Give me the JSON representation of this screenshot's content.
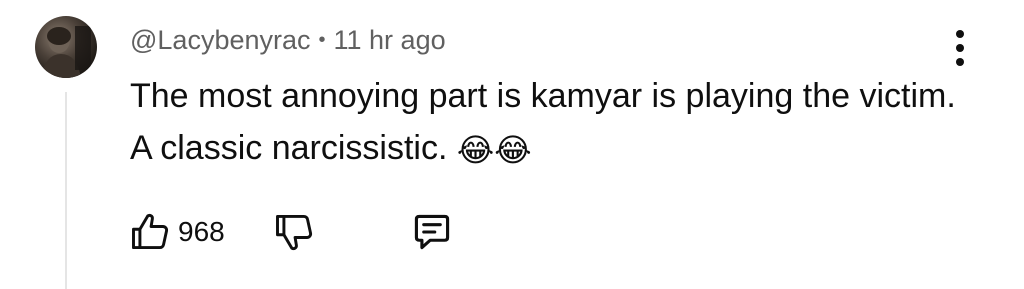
{
  "comment": {
    "username": "@Lacybenyrac",
    "separator": "•",
    "timestamp": "11 hr ago",
    "text": "The most annoying part is kamyar is playing the victim. A classic narcissistic.",
    "emojis": "😂😂"
  },
  "actions": {
    "like_count": "968",
    "like_icon": "thumbs-up-icon",
    "dislike_icon": "thumbs-down-icon",
    "reply_icon": "reply-icon"
  },
  "menu": {
    "icon": "more-vertical-icon"
  },
  "colors": {
    "text": "#0f0f0f",
    "meta": "#606060",
    "thread_line": "#e5e5e5",
    "background": "#ffffff"
  }
}
